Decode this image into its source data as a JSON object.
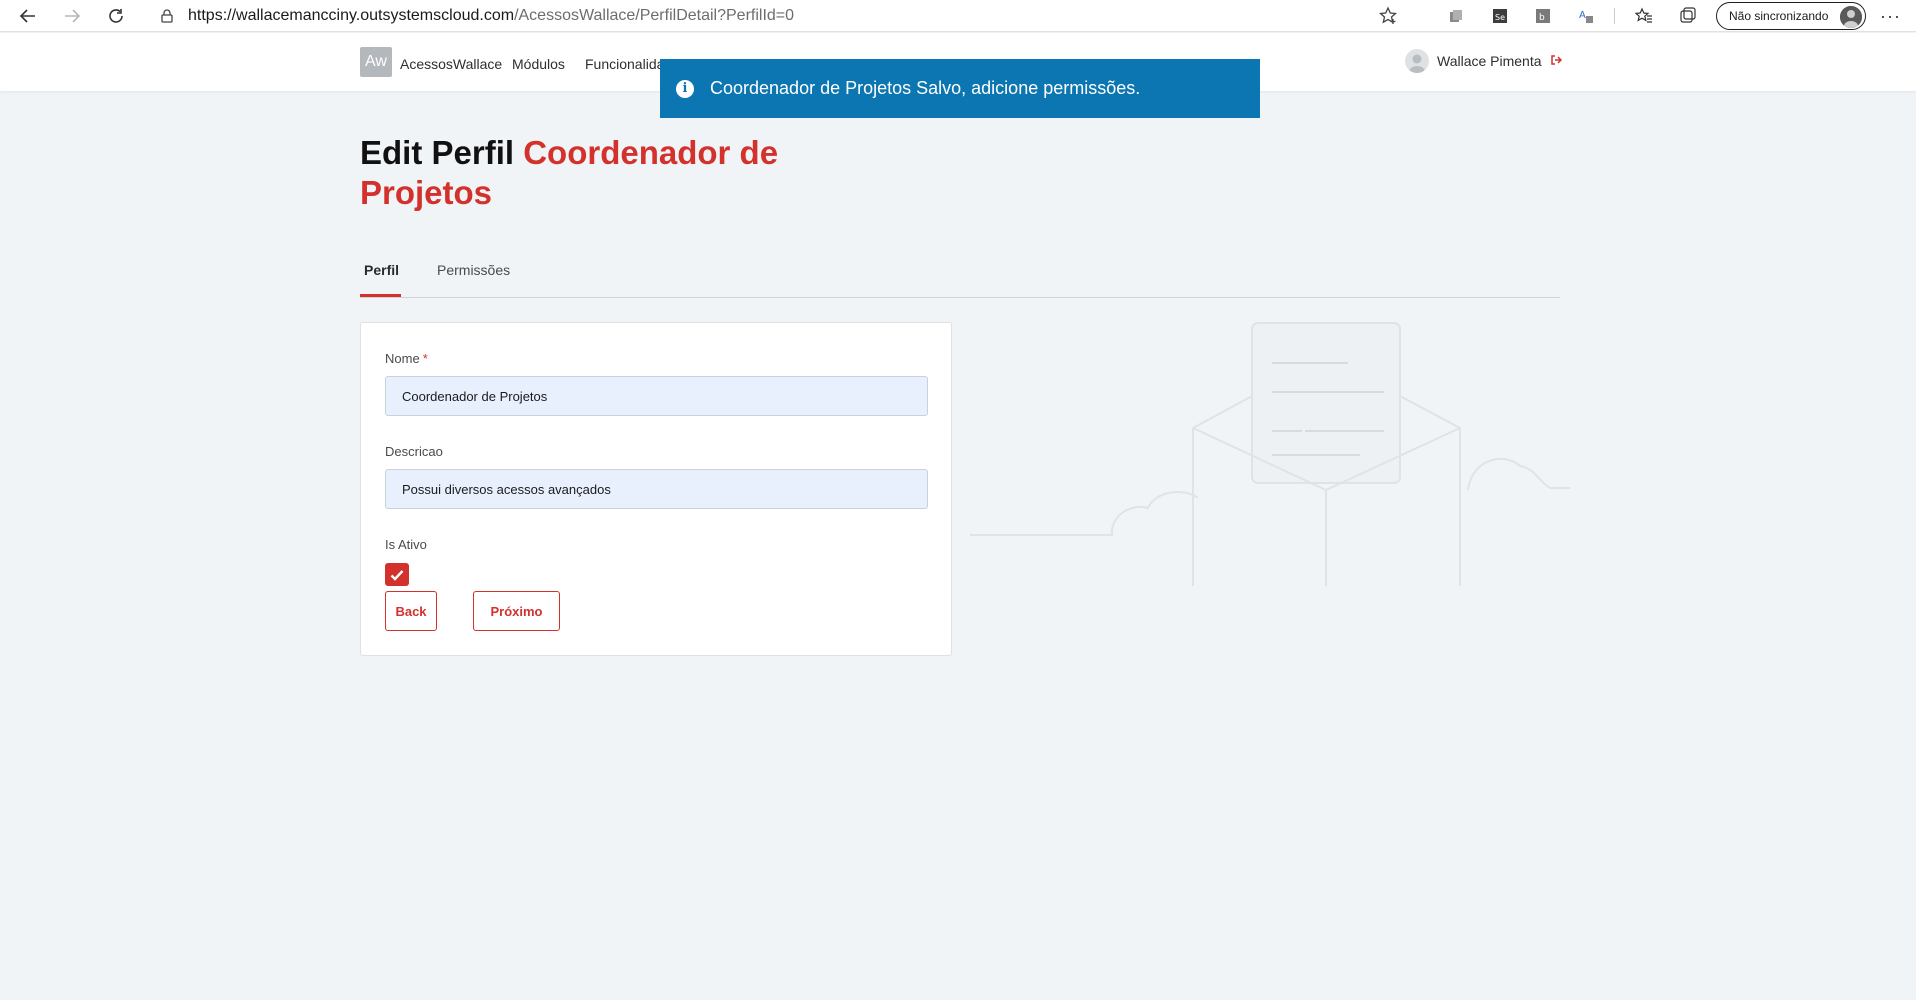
{
  "browser": {
    "url_host": "https://wallacemancciny.outsystemscloud.com",
    "url_path": "/AcessosWallace/PerfilDetail?PerfilId=0",
    "sync_label": "Não sincronizando"
  },
  "header": {
    "logo_text": "Aw",
    "app_name": "AcessosWallace",
    "menu": [
      "Módulos",
      "Funcionalidades"
    ],
    "user_name": "Wallace Pimenta"
  },
  "toast": {
    "message": "Coordenador de Projetos Salvo, adicione permissões."
  },
  "page": {
    "title_prefix": "Edit Perfil",
    "title_name": "Coordenador de Projetos"
  },
  "tabs": [
    {
      "label": "Perfil",
      "active": true
    },
    {
      "label": "Permissões",
      "active": false
    }
  ],
  "form": {
    "nome_label": "Nome",
    "nome_required_mark": "*",
    "nome_value": "Coordenador de Projetos",
    "descricao_label": "Descricao",
    "descricao_value": "Possui diversos acessos avançados",
    "ativo_label": "Is Ativo",
    "ativo_checked": true,
    "back_label": "Back",
    "next_label": "Próximo"
  },
  "colors": {
    "accent": "#d2312c",
    "toast_bg": "#0b76b1",
    "page_bg": "#f1f4f7"
  }
}
